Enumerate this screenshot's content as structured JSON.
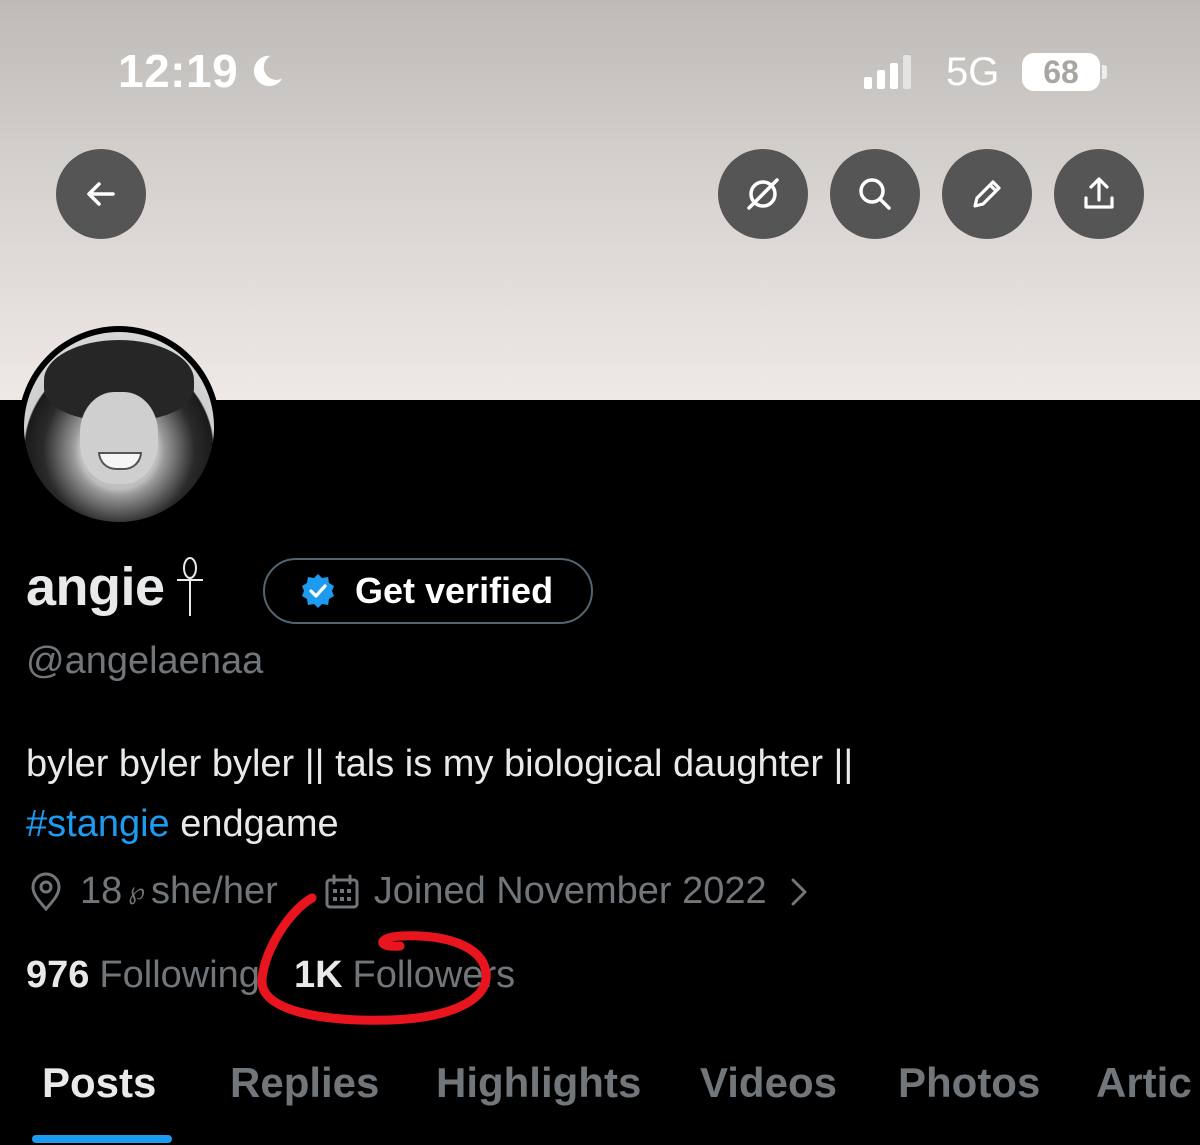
{
  "status_bar": {
    "time": "12:19",
    "network": "5G",
    "battery": "68"
  },
  "header": {
    "buttons": [
      {
        "name": "back",
        "icon": "back-arrow-icon"
      },
      {
        "name": "grok",
        "icon": "slash-circle-icon"
      },
      {
        "name": "search",
        "icon": "search-icon"
      },
      {
        "name": "edit",
        "icon": "pencil-icon"
      },
      {
        "name": "share",
        "icon": "share-icon"
      }
    ]
  },
  "profile": {
    "display_name": "angie",
    "handle": "@angelaenaa",
    "verify_label": "Get verified",
    "bio_main": "byler byler byler || tals is my biological daughter ||",
    "bio_hashtag": "#stangie",
    "bio_tail": " endgame",
    "location_text": "18 ",
    "location_symbol": "℘",
    "pronouns": " she/her",
    "joined": "Joined November 2022",
    "following_count": "976",
    "following_label": "Following",
    "followers_count": "1K",
    "followers_label": "Followers"
  },
  "tabs": [
    {
      "label": "Posts",
      "active": true
    },
    {
      "label": "Replies",
      "active": false
    },
    {
      "label": "Highlights",
      "active": false
    },
    {
      "label": "Videos",
      "active": false
    },
    {
      "label": "Photos",
      "active": false
    },
    {
      "label": "Artic",
      "active": false
    }
  ],
  "colors": {
    "background": "#000000",
    "accent": "#1d9bf0",
    "muted_text": "#71767b",
    "annotation": "#e8141e"
  }
}
